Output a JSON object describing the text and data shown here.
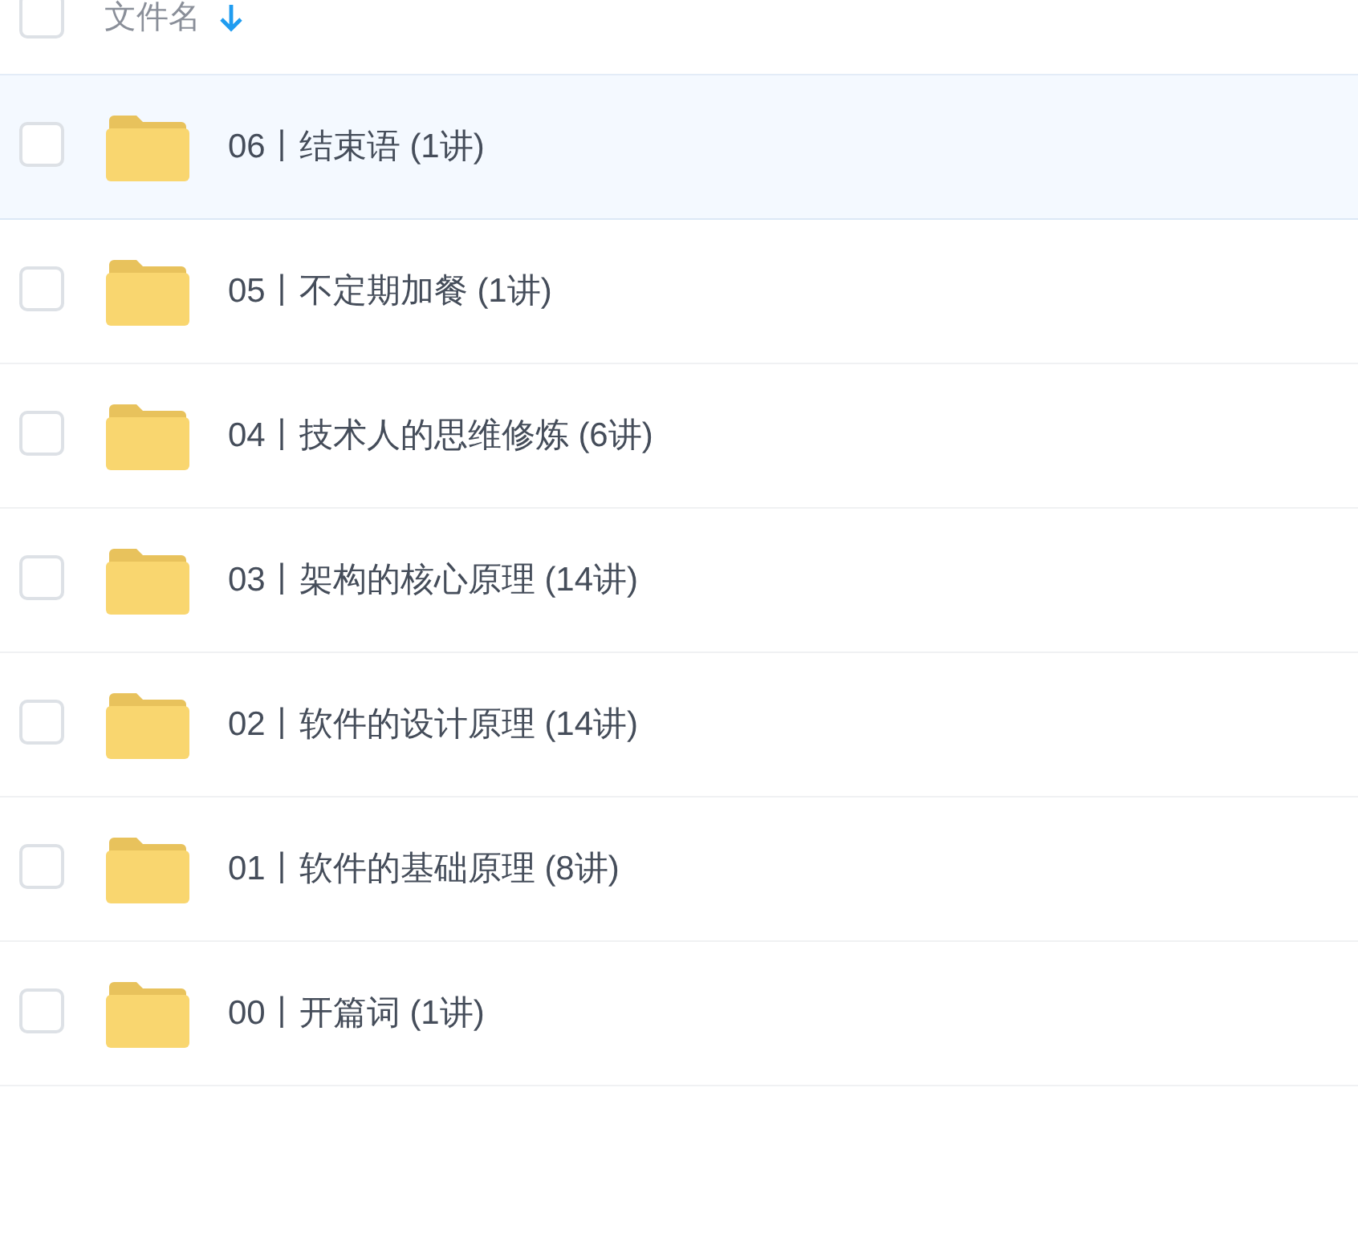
{
  "header": {
    "checked": false,
    "label": "文件名"
  },
  "rows": [
    {
      "name": "06丨结束语 (1讲)",
      "checked": false,
      "highlighted": true
    },
    {
      "name": "05丨不定期加餐 (1讲)",
      "checked": false,
      "highlighted": false
    },
    {
      "name": "04丨技术人的思维修炼 (6讲)",
      "checked": false,
      "highlighted": false
    },
    {
      "name": "03丨架构的核心原理 (14讲)",
      "checked": false,
      "highlighted": false
    },
    {
      "name": "02丨软件的设计原理 (14讲)",
      "checked": false,
      "highlighted": false
    },
    {
      "name": "01丨软件的基础原理 (8讲)",
      "checked": false,
      "highlighted": false
    },
    {
      "name": "00丨开篇词 (1讲)",
      "checked": false,
      "highlighted": false
    }
  ]
}
